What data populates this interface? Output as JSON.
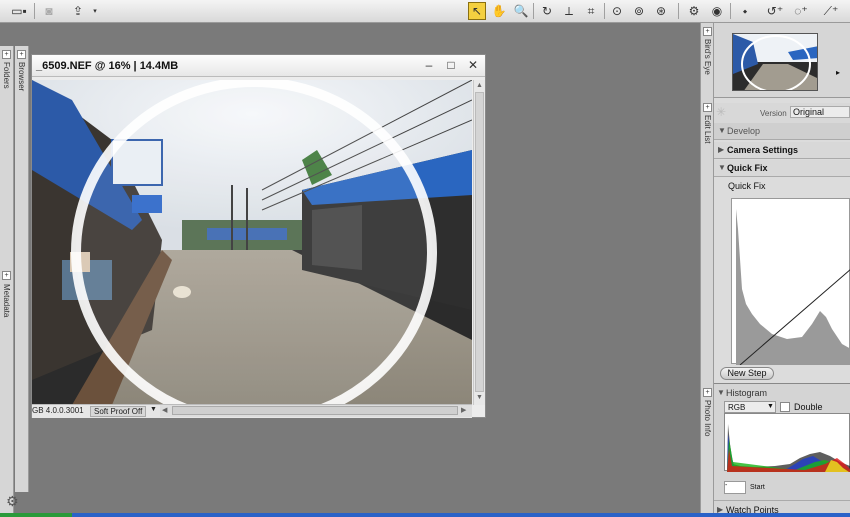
{
  "image_window": {
    "title": "_6509.NEF @ 16% | 14.4MB",
    "status_left": "GB 4.0.0.3001",
    "soft_proof": "Soft Proof Off"
  },
  "left_panel": {
    "folders_label": "Folders",
    "browser_label": "Browser",
    "metadata_label": "Metadata"
  },
  "right_panel": {
    "birds_eye_label": "Bird's Eye",
    "edit_list_label": "Edit List",
    "photo_info_label": "Photo Info",
    "version_label": "Version",
    "version_value": "Original",
    "develop_label": "Develop",
    "camera_settings_label": "Camera Settings",
    "quick_fix_label": "Quick Fix",
    "quick_fix_sub_label": "Quick Fix",
    "new_step_label": "New Step",
    "histogram_label": "Histogram",
    "rgb_option": "RGB",
    "double_threshold_label": "Double Thresho",
    "start_label": "Start",
    "start_value": "-",
    "watch_points_label": "Watch Points"
  },
  "colors": {
    "toolbar_active": "#f4d040",
    "panel_bg": "#d6d6d6",
    "workspace_bg": "#7a7a7a"
  }
}
